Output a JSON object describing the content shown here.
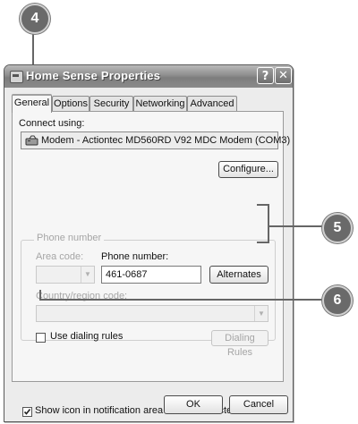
{
  "callouts": {
    "c4": "4",
    "c5": "5",
    "c6": "6"
  },
  "window": {
    "title": "Home Sense Properties",
    "help_btn": "?",
    "close_btn": "✕",
    "tabs": [
      "General",
      "Options",
      "Security",
      "Networking",
      "Advanced"
    ],
    "connect_using_label": "Connect using:",
    "modem_name": "Modem - Actiontec MD560RD V92 MDC Modem (COM3)",
    "configure_btn": "Configure...",
    "phone_group_title": "Phone number",
    "area_code_label": "Area code:",
    "phone_number_label": "Phone number:",
    "phone_number_value": "461-0687",
    "alternates_btn": "Alternates",
    "country_label": "Country/region code:",
    "use_dialing_rules": "Use dialing rules",
    "dialing_rules_btn": "Dialing Rules",
    "show_icon_label": "Show icon in notification area when connected",
    "show_icon_checked": true,
    "ok_btn": "OK",
    "cancel_btn": "Cancel"
  },
  "icons": {
    "modem": "modem-icon",
    "app": "dialup-connection-icon",
    "combo_arrow": "chevron-down-icon"
  }
}
